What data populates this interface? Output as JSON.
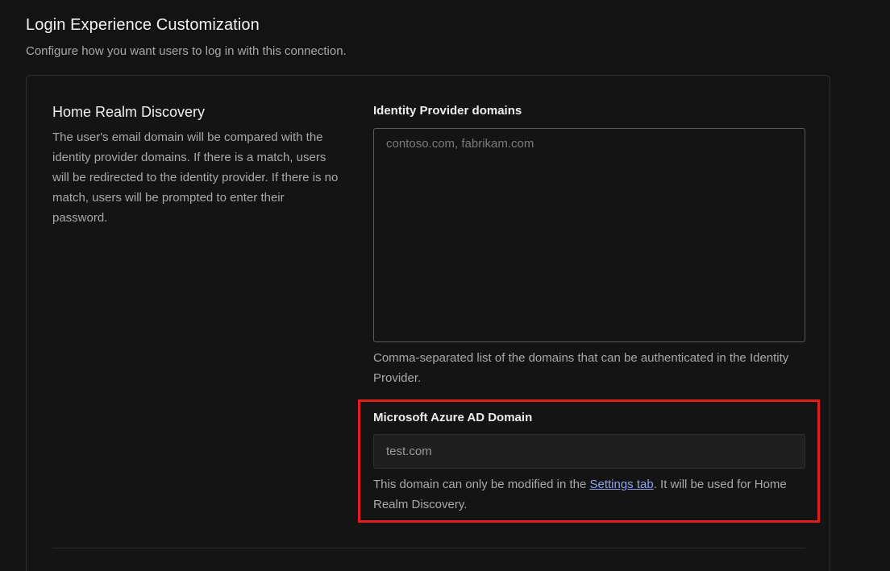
{
  "section": {
    "title": "Login Experience Customization",
    "subtitle": "Configure how you want users to log in with this connection."
  },
  "home_realm_discovery": {
    "title": "Home Realm Discovery",
    "description": "The user's email domain will be compared with the identity provider domains. If there is a match, users will be redirected to the identity provider. If there is no match, users will be prompted to enter their password."
  },
  "idp_domains": {
    "label": "Identity Provider domains",
    "placeholder": "contoso.com, fabrikam.com",
    "value": "",
    "help": "Comma-separated list of the domains that can be authenticated in the Identity Provider."
  },
  "azure_ad_domain": {
    "label": "Microsoft Azure AD Domain",
    "value": "test.com",
    "help_prefix": "This domain can only be modified in the ",
    "help_link": "Settings tab",
    "help_suffix": ". It will be used for Home Realm Discovery."
  },
  "colors": {
    "highlight_border": "#e01e1e",
    "link": "#8ea3ee",
    "background": "#131313"
  }
}
